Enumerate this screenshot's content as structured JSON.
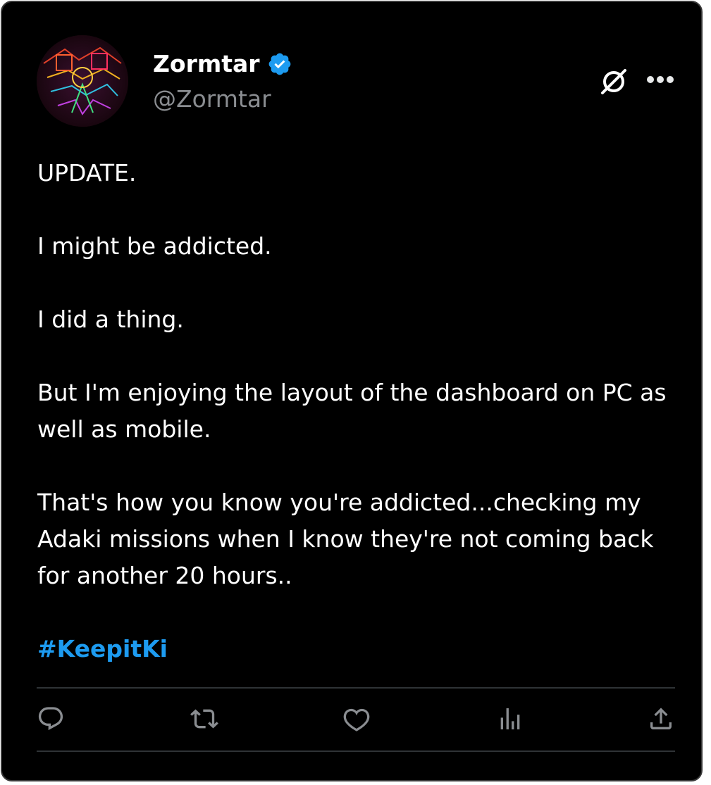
{
  "author": {
    "display_name": "Zormtar",
    "handle": "@Zormtar",
    "verified_icon": "verified-badge-icon"
  },
  "header_icons": {
    "platform_logo": "x-logo-icon",
    "more": "more-options-icon"
  },
  "post": {
    "paragraphs": [
      "UPDATE.",
      "I might be addicted.",
      "I did a thing.",
      "But I'm enjoying the layout of the dashboard on PC as well as mobile.",
      "That's how you know you're addicted...checking my Adaki missions when I know they're not coming back for another 20 hours.."
    ],
    "hashtag": "#KeepitKi"
  },
  "actions": [
    {
      "name": "reply",
      "icon": "reply-icon"
    },
    {
      "name": "repost",
      "icon": "repost-icon"
    },
    {
      "name": "like",
      "icon": "heart-icon"
    },
    {
      "name": "views",
      "icon": "analytics-icon"
    },
    {
      "name": "share",
      "icon": "share-icon"
    }
  ],
  "colors": {
    "background": "#000000",
    "text": "#ffffff",
    "secondary_text": "#8a8d91",
    "accent": "#1d9bf0",
    "divider": "#2f3336"
  }
}
